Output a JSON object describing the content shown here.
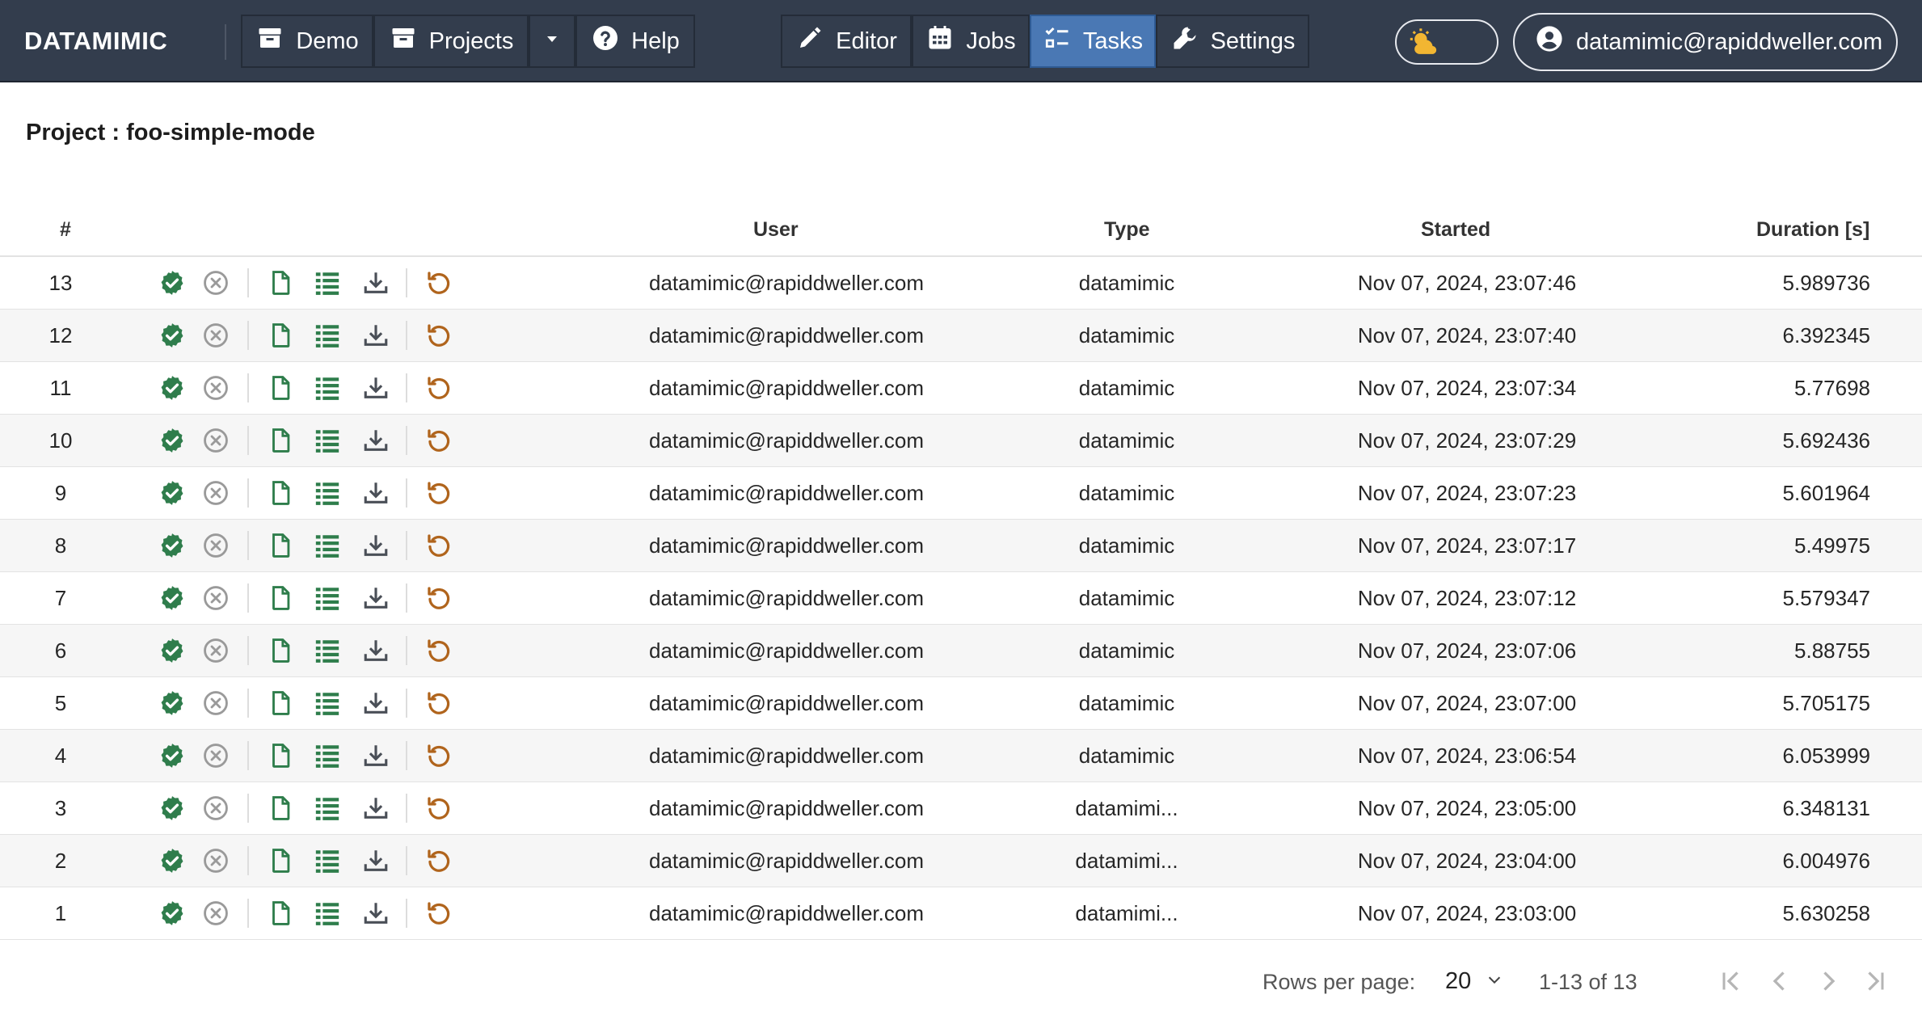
{
  "app": {
    "brand": "DATAMIMIC"
  },
  "nav_left": [
    {
      "label": "Demo",
      "icon": "archive-box-icon"
    },
    {
      "label": "Projects",
      "icon": "archive-box-icon"
    },
    {
      "label": "",
      "icon": "caret-down-icon"
    },
    {
      "label": "Help",
      "icon": "question-circle-icon"
    }
  ],
  "nav_center": [
    {
      "label": "Editor",
      "icon": "pencil-icon"
    },
    {
      "label": "Jobs",
      "icon": "calendar-icon"
    },
    {
      "label": "Tasks",
      "icon": "tasks-list-icon",
      "active": true
    },
    {
      "label": "Settings",
      "icon": "wrench-icon"
    }
  ],
  "theme_toggle": {
    "icon": "cloud-sun-icon"
  },
  "user": {
    "email": "datamimic@rapiddweller.com",
    "icon": "user-circle-icon"
  },
  "project": {
    "title": "Project : foo-simple-mode"
  },
  "table": {
    "headers": {
      "num": "#",
      "user": "User",
      "type": "Type",
      "started": "Started",
      "duration": "Duration [s]"
    },
    "rows": [
      {
        "num": "13",
        "user": "datamimic@rapiddweller.com",
        "type": "datamimic",
        "started": "Nov 07, 2024, 23:07:46",
        "duration": "5.989736"
      },
      {
        "num": "12",
        "user": "datamimic@rapiddweller.com",
        "type": "datamimic",
        "started": "Nov 07, 2024, 23:07:40",
        "duration": "6.392345"
      },
      {
        "num": "11",
        "user": "datamimic@rapiddweller.com",
        "type": "datamimic",
        "started": "Nov 07, 2024, 23:07:34",
        "duration": "5.77698"
      },
      {
        "num": "10",
        "user": "datamimic@rapiddweller.com",
        "type": "datamimic",
        "started": "Nov 07, 2024, 23:07:29",
        "duration": "5.692436"
      },
      {
        "num": "9",
        "user": "datamimic@rapiddweller.com",
        "type": "datamimic",
        "started": "Nov 07, 2024, 23:07:23",
        "duration": "5.601964"
      },
      {
        "num": "8",
        "user": "datamimic@rapiddweller.com",
        "type": "datamimic",
        "started": "Nov 07, 2024, 23:07:17",
        "duration": "5.49975"
      },
      {
        "num": "7",
        "user": "datamimic@rapiddweller.com",
        "type": "datamimic",
        "started": "Nov 07, 2024, 23:07:12",
        "duration": "5.579347"
      },
      {
        "num": "6",
        "user": "datamimic@rapiddweller.com",
        "type": "datamimic",
        "started": "Nov 07, 2024, 23:07:06",
        "duration": "5.88755"
      },
      {
        "num": "5",
        "user": "datamimic@rapiddweller.com",
        "type": "datamimic",
        "started": "Nov 07, 2024, 23:07:00",
        "duration": "5.705175"
      },
      {
        "num": "4",
        "user": "datamimic@rapiddweller.com",
        "type": "datamimic",
        "started": "Nov 07, 2024, 23:06:54",
        "duration": "6.053999"
      },
      {
        "num": "3",
        "user": "datamimic@rapiddweller.com",
        "type": "datamimi...",
        "started": "Nov 07, 2024, 23:05:00",
        "duration": "6.348131"
      },
      {
        "num": "2",
        "user": "datamimic@rapiddweller.com",
        "type": "datamimi...",
        "started": "Nov 07, 2024, 23:04:00",
        "duration": "6.004976"
      },
      {
        "num": "1",
        "user": "datamimic@rapiddweller.com",
        "type": "datamimi...",
        "started": "Nov 07, 2024, 23:03:00",
        "duration": "5.630258"
      }
    ],
    "row_icons": [
      "check-circle-icon",
      "cancel-circle-icon",
      "file-icon",
      "list-icon",
      "download-icon",
      "rerun-icon"
    ]
  },
  "pagination": {
    "rows_per_page_label": "Rows per page:",
    "rows_per_page_value": "20",
    "range_label": "1-13 of 13",
    "buttons": [
      "first-page-icon",
      "prev-page-icon",
      "next-page-icon",
      "last-page-icon"
    ]
  },
  "colors": {
    "topbar": "#333d4d",
    "active_tab": "#4a78b4",
    "success_green": "#2f7d4c",
    "file_green": "#2e7d4b",
    "rerun_orange": "#b0641c",
    "sun_yellow": "#f2b632"
  }
}
